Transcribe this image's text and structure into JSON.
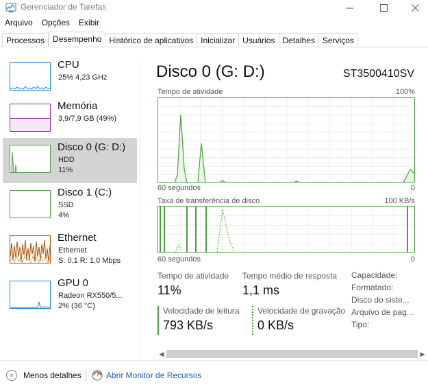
{
  "window": {
    "title": "Gerenciador de Tarefas"
  },
  "menu": [
    "Arquivo",
    "Opções",
    "Exibir"
  ],
  "tabs": [
    "Processos",
    "Desempenho",
    "Histórico de aplicativos",
    "Inicializar",
    "Usuários",
    "Detalhes",
    "Serviços"
  ],
  "active_tab": "Desempenho",
  "resources": {
    "cpu": {
      "name": "CPU",
      "detail": "25% 4,23 GHz"
    },
    "memory": {
      "name": "Memória",
      "detail": "3,9/7,9 GB (49%)"
    },
    "disk0": {
      "name": "Disco 0 (G: D:)",
      "type": "HDD",
      "usage": "11%"
    },
    "disk1": {
      "name": "Disco 1 (C:)",
      "type": "SSD",
      "usage": "4%"
    },
    "ethernet": {
      "name": "Ethernet",
      "adapter": "Ethernet",
      "rate": "S: 0,1  R: 1,0 Mbps"
    },
    "gpu": {
      "name": "GPU 0",
      "model": "Radeon RX550/5...",
      "usage": "2% (36 °C)"
    }
  },
  "detail": {
    "title": "Disco 0 (G: D:)",
    "model": "ST3500410SV",
    "graph1": {
      "label": "Tempo de atividade",
      "max": "100%",
      "time": "60 segundos",
      "min": "0"
    },
    "graph2": {
      "label": "Taxa de transferência de disco",
      "max": "100 KB/s",
      "time": "60 segundos",
      "min": "0"
    },
    "stats": {
      "active_time_label": "Tempo de atividade",
      "active_time_value": "11%",
      "response_label": "Tempo médio de resposta",
      "response_value": "1,1 ms",
      "read_label": "Velocidade de leitura",
      "read_value": "793 KB/s",
      "write_label": "Velocidade de gravação",
      "write_value": "0 KB/s"
    },
    "side": [
      "Capacidade:",
      "Formatado:",
      "Disco do siste...",
      "Arquivo de pag...",
      "Tipo:"
    ]
  },
  "footer": {
    "fewer_details": "Menos detalhes",
    "resource_monitor": "Abrir Monitor de Recursos"
  },
  "colors": {
    "disk_green": "#4aa03f",
    "cpu_blue": "#1786c6",
    "memory_purple": "#8b2c9e",
    "ethernet_orange": "#a74f01",
    "link_blue": "#1a5fb4"
  }
}
